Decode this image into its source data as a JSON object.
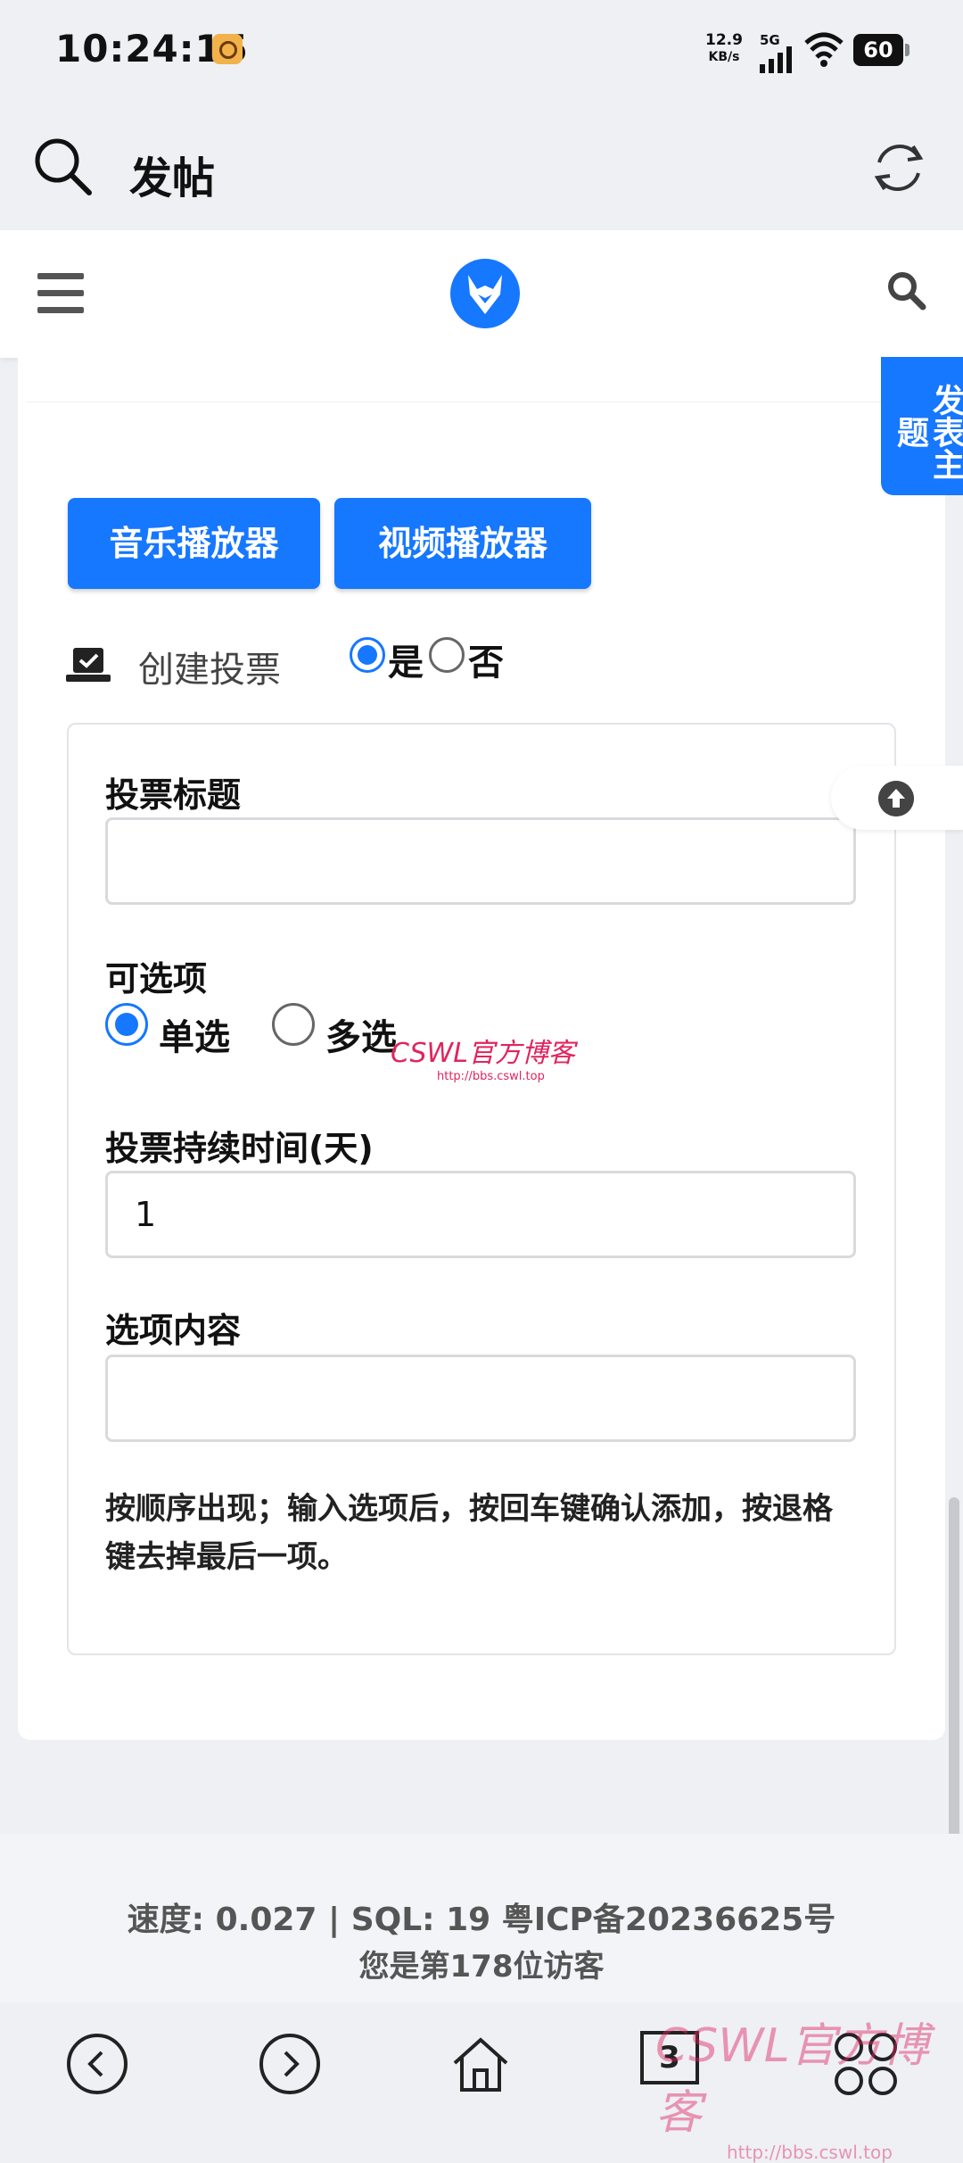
{
  "status_bar": {
    "time": "10:24:15",
    "net_speed_value": "12.9",
    "net_speed_unit": "KB/s",
    "net_type": "5G",
    "battery": "60"
  },
  "browser": {
    "title": "发帖",
    "search_icon": "search-icon",
    "refresh_icon": "refresh-icon"
  },
  "site_header": {
    "menu_icon": "menu-icon",
    "logo": "site-logo",
    "search_icon": "search-icon"
  },
  "side_tab": {
    "label": "发表主题"
  },
  "editor": {
    "music_button": "音乐播放器",
    "video_button": "视频播放器"
  },
  "vote": {
    "label": "创建投票",
    "yes": "是",
    "no": "否",
    "selected": "是"
  },
  "poll": {
    "title_label": "投票标题",
    "title_value": "",
    "options_label": "可选项",
    "single": "单选",
    "multi": "多选",
    "selected_mode": "单选",
    "duration_label": "投票持续时间(天)",
    "duration_value": "1",
    "option_content_label": "选项内容",
    "option_content_value": "",
    "hint": "按顺序出现；输入选项后，按回车键确认添加，按退格键去掉最后一项。"
  },
  "watermark": {
    "text": "CSWL官方博客",
    "url": "http://bbs.cswl.top"
  },
  "footer": {
    "stats": "速度: 0.027 | SQL: 19 粤ICP备20236625号",
    "visitors": "您是第178位访客"
  },
  "bottom_nav": {
    "tab_count": "3"
  },
  "colors": {
    "accent": "#1677ff",
    "background": "#eef0f4",
    "watermark": "#e0245e"
  }
}
